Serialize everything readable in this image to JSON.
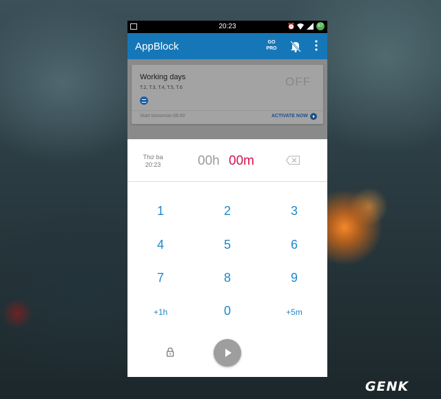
{
  "status_bar": {
    "time": "20:23",
    "battery": "87"
  },
  "app": {
    "title": "AppBlock",
    "go_pro": [
      "GO",
      "PRO"
    ]
  },
  "card": {
    "name": "Working days",
    "days": "T.2, T.3, T.4, T.5, T.6",
    "state": "OFF",
    "start_text": "Start tomorrow 08:00",
    "activate_label": "ACTIVATE NOW"
  },
  "timer": {
    "day": "Thứ ba",
    "time": "20:23",
    "hours": "00h",
    "minutes": "00m"
  },
  "keypad": {
    "k1": "1",
    "k2": "2",
    "k3": "3",
    "k4": "4",
    "k5": "5",
    "k6": "6",
    "k7": "7",
    "k8": "8",
    "k9": "9",
    "plus1h": "+1h",
    "k0": "0",
    "plus5m": "+5m"
  },
  "watermark": "GENK",
  "icons": [
    "image-icon",
    "alarm-icon",
    "wifi-icon",
    "signal-icon",
    "battery-icon",
    "bell-off-icon",
    "more-vert-icon",
    "messenger-icon",
    "arrow-right-icon",
    "backspace-icon",
    "lock-icon",
    "play-icon"
  ],
  "colors": {
    "toolbar": "#1677b8",
    "accent_minutes": "#d1124a",
    "keypad_digits": "#1e88c8"
  }
}
